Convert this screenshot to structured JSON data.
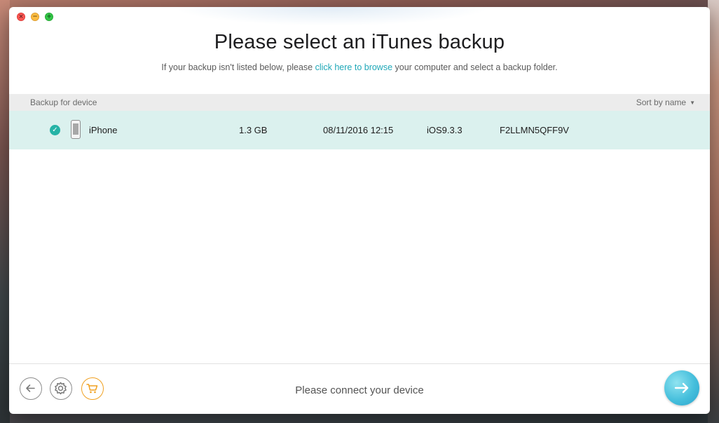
{
  "window": {
    "title": "Please select an iTunes backup",
    "subtitle_before": "If your backup isn't listed below, please ",
    "subtitle_link": "click here to browse",
    "subtitle_after": " your computer and select a backup folder."
  },
  "list": {
    "header_left": "Backup for device",
    "sort_label": "Sort by name",
    "rows": [
      {
        "selected": true,
        "icon": "iphone-icon",
        "name": "iPhone",
        "size": "1.3 GB",
        "date": "08/11/2016 12:15",
        "ios": "iOS9.3.3",
        "id": "F2LLMN5QFF9V"
      }
    ]
  },
  "footer": {
    "status": "Please connect your device",
    "icons": [
      "back-arrow-icon",
      "gear-icon",
      "cart-icon",
      "next-arrow-icon"
    ]
  },
  "colors": {
    "accent": "#1fa8b8",
    "selected_row": "#dbf1ee",
    "check": "#25b3a6",
    "cart": "#f0a020"
  }
}
